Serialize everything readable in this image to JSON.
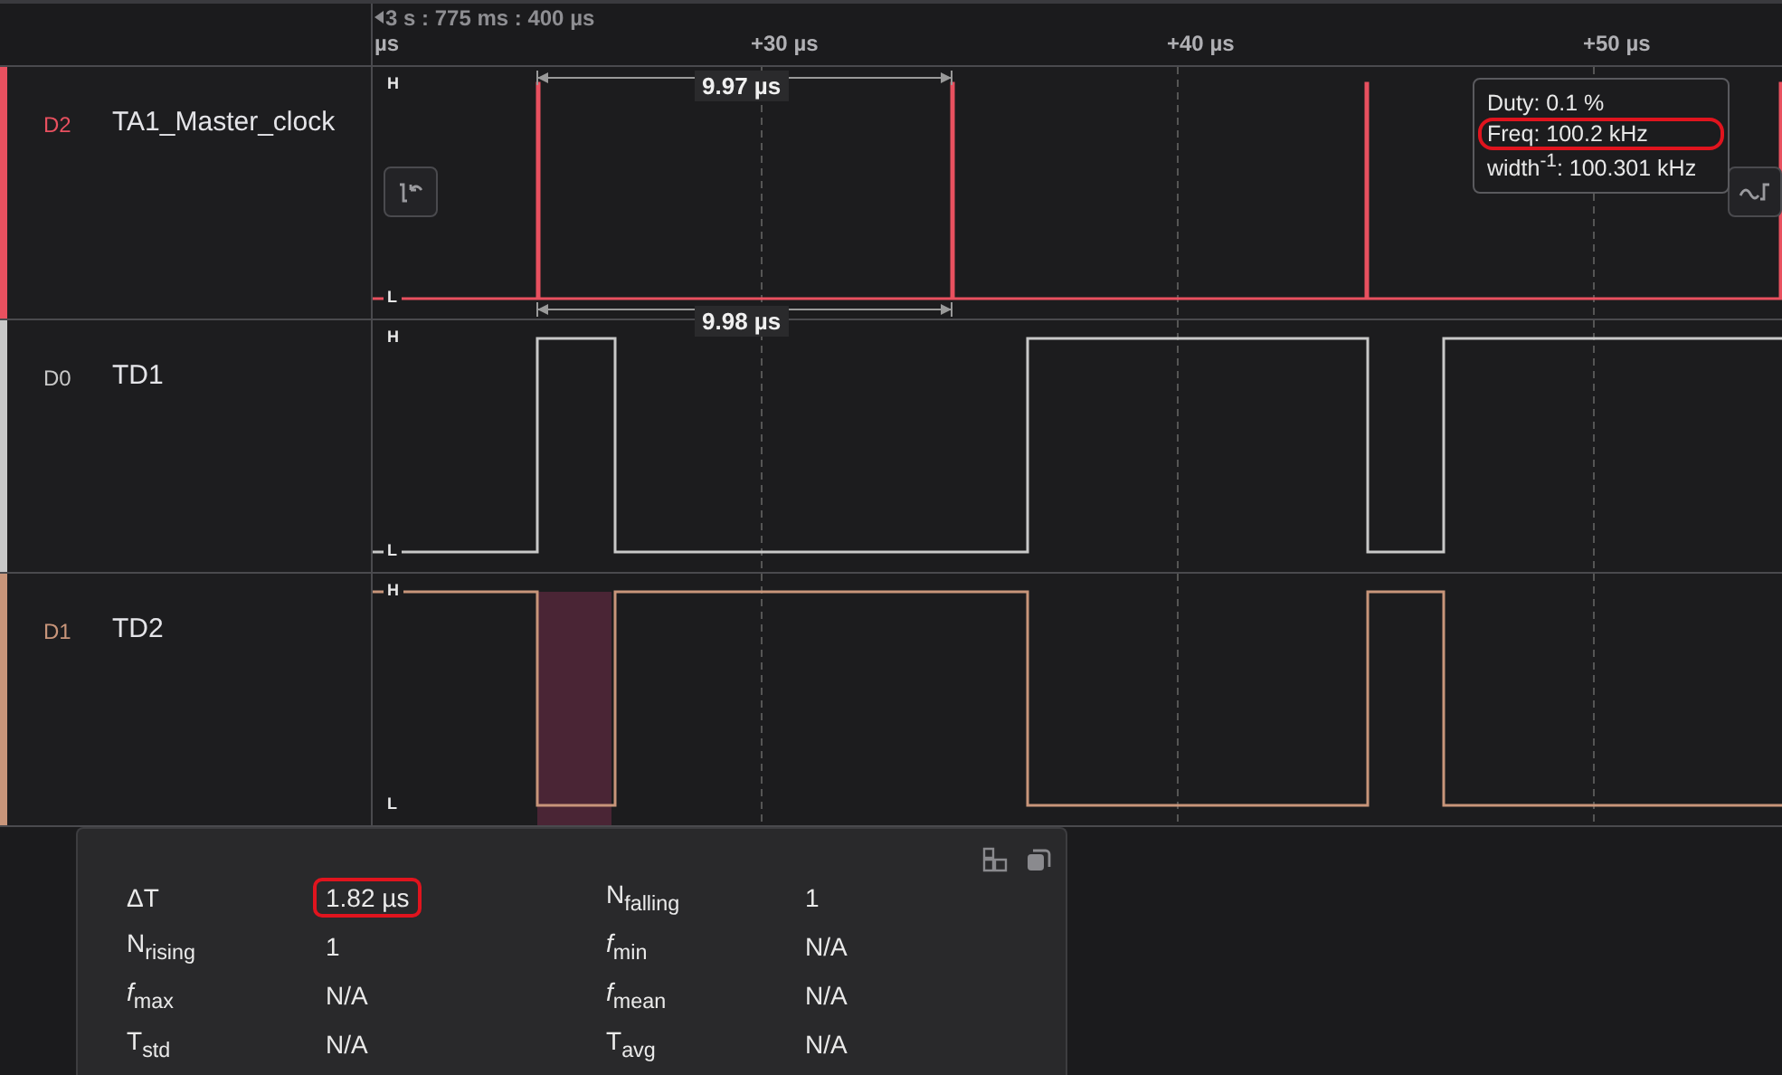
{
  "timeline": {
    "origin": "3 s : 775 ms : 400 µs",
    "ticks": [
      {
        "label": "µs"
      },
      {
        "label": "+30 µs"
      },
      {
        "label": "+40 µs"
      },
      {
        "label": "+50 µs"
      }
    ]
  },
  "channels": [
    {
      "id": "D2",
      "name": "TA1_Master_clock",
      "color": "#e8505f",
      "high": "H",
      "low": "L"
    },
    {
      "id": "D0",
      "name": "TD1",
      "color": "#c8c8c8",
      "high": "H",
      "low": "L"
    },
    {
      "id": "D1",
      "name": "TD2",
      "color": "#c8957a",
      "high": "H",
      "low": "L"
    }
  ],
  "measurements": [
    {
      "label": "9.97 µs"
    },
    {
      "label": "9.98 µs"
    }
  ],
  "tooltip": {
    "lines": [
      {
        "text": "Duty: 0.1 %",
        "circled": false
      },
      {
        "text": "Freq: 100.2 kHz",
        "circled": true
      },
      {
        "text": "width$^{-1}$: 100.301 kHz",
        "circled": false
      }
    ]
  },
  "stats": [
    {
      "label": "ΔT",
      "value": "1.82 µs",
      "circled": true
    },
    {
      "label": "N$_{falling}$",
      "value": "1",
      "circled": false
    },
    {
      "label": "N$_{rising}$",
      "value": "1",
      "circled": false
    },
    {
      "label": "*f*$_{min}$",
      "value": "N/A",
      "circled": false
    },
    {
      "label": "*f*$_{max}$",
      "value": "N/A",
      "circled": false
    },
    {
      "label": "*f*$_{mean}$",
      "value": "N/A",
      "circled": false
    },
    {
      "label": "T$_{std}$",
      "value": "N/A",
      "circled": false
    },
    {
      "label": "T$_{avg}$",
      "value": "N/A",
      "circled": false
    }
  ]
}
